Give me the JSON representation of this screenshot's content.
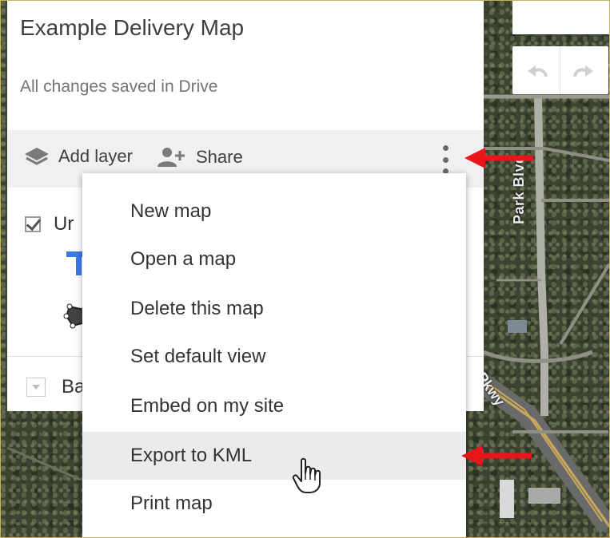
{
  "app": {
    "title": "Example Delivery Map",
    "save_status": "All changes saved in Drive"
  },
  "toolbar": {
    "add_layer_label": "Add layer",
    "share_label": "Share"
  },
  "layers": {
    "layer_label_partial": "Ur",
    "base_label_partial": "Ba"
  },
  "menu": {
    "items": [
      {
        "label": "New map"
      },
      {
        "label": "Open a map"
      },
      {
        "label": "Delete this map"
      },
      {
        "label": "Set default view"
      },
      {
        "label": "Embed on my site"
      },
      {
        "label": "Export to KML",
        "highlighted": true
      },
      {
        "label": "Print map"
      }
    ]
  },
  "map": {
    "street_labels": [
      "Park Blvd",
      "Pkwy"
    ]
  },
  "annotations": {
    "arrow_color": "#e8161b",
    "arrow_targets": [
      "more-options-button",
      "menu-item-export-kml"
    ]
  },
  "icons": [
    "layers-icon",
    "add-person-icon",
    "more-vert-icon",
    "undo-icon",
    "redo-icon",
    "checkbox-icon",
    "route-icon",
    "polygon-icon",
    "dropdown-icon",
    "hand-pointer-icon"
  ]
}
